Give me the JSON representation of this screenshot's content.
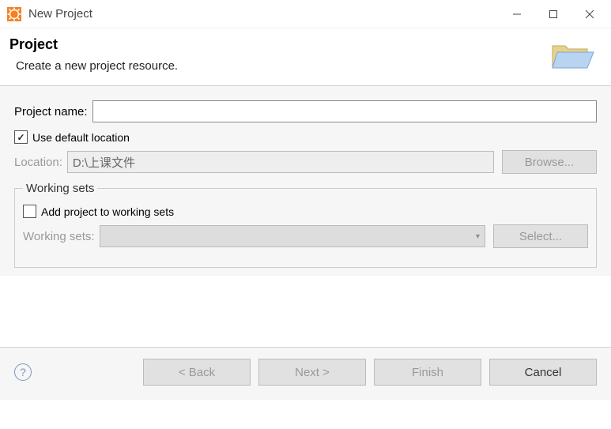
{
  "window": {
    "title": "New Project"
  },
  "header": {
    "title": "Project",
    "subtitle": "Create a new project resource."
  },
  "form": {
    "project_name_label": "Project name:",
    "project_name_value": "",
    "use_default_location_label": "Use default location",
    "use_default_location_checked": true,
    "location_label": "Location:",
    "location_value": "D:\\上课文件",
    "browse_label": "Browse...",
    "working_sets": {
      "legend": "Working sets",
      "add_label": "Add project to working sets",
      "add_checked": false,
      "sets_label": "Working sets:",
      "select_label": "Select..."
    }
  },
  "footer": {
    "back_label": "< Back",
    "next_label": "Next >",
    "finish_label": "Finish",
    "cancel_label": "Cancel"
  }
}
